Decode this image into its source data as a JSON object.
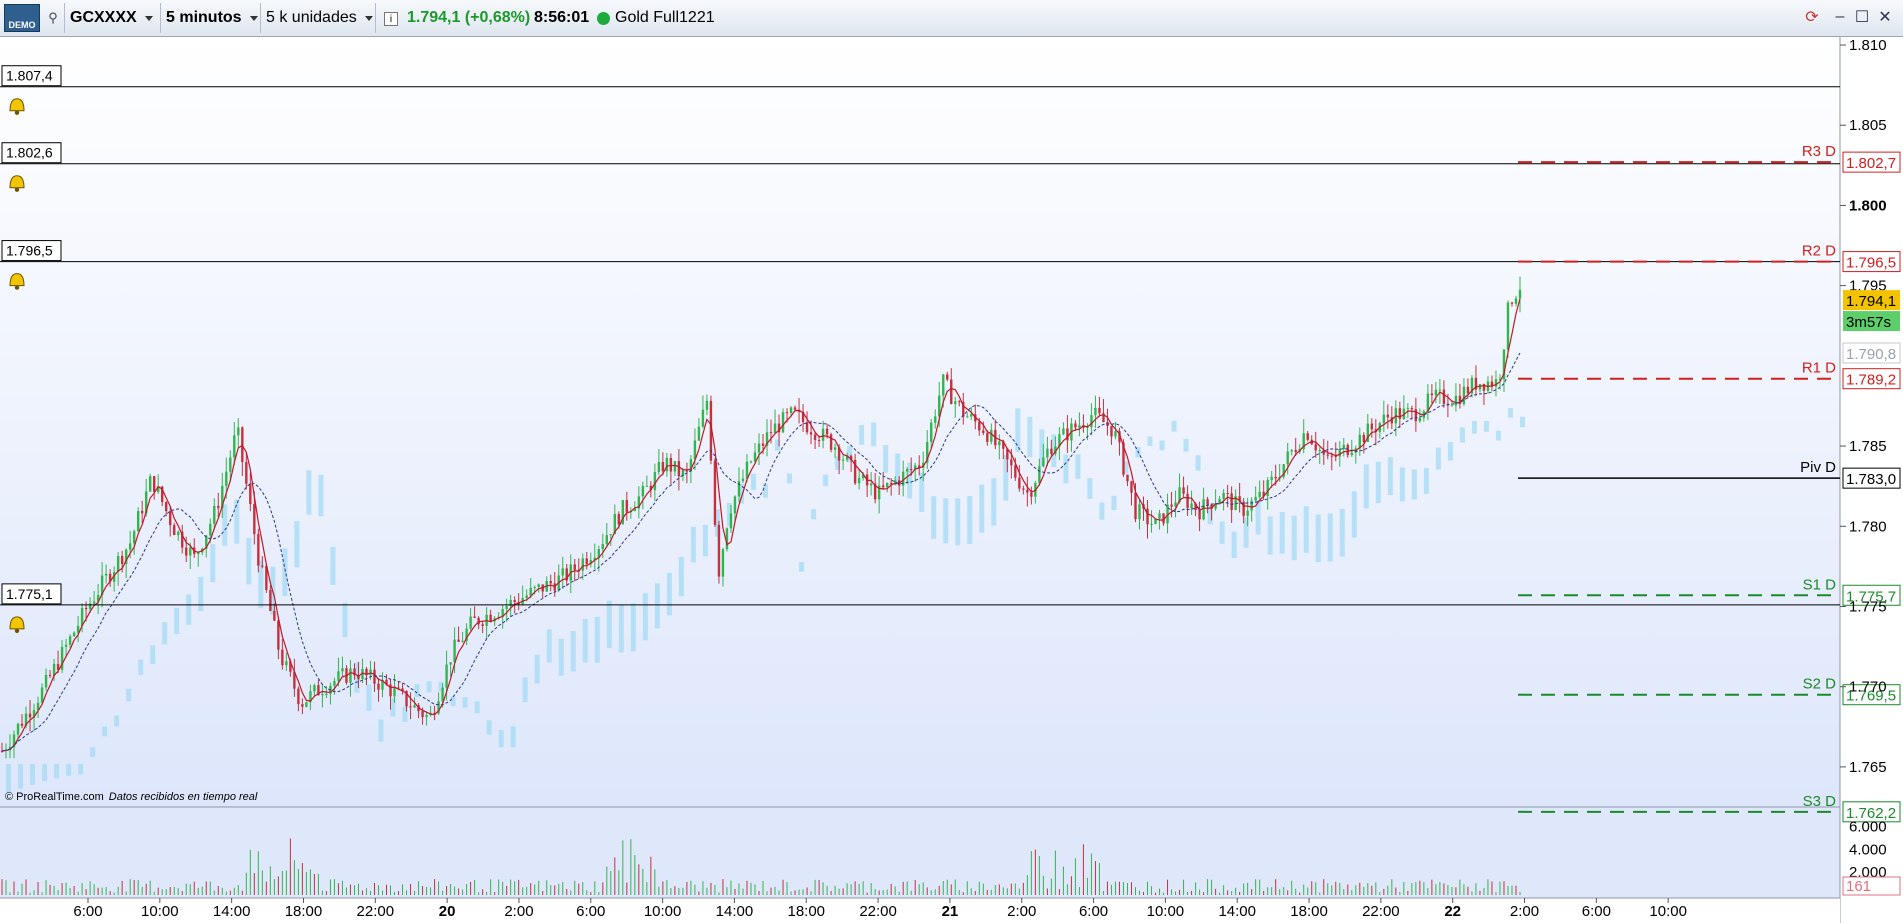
{
  "toolbar": {
    "demo_label": "DEMO",
    "symbol": "GCXXXX",
    "period": "5 minutos",
    "units": "5 k unidades",
    "info_icon": "i",
    "last_price": "1.794,1 (+0,68%)",
    "clock": "8:56:01",
    "instrument": "Gold Full1221",
    "status_color": "#1faa3c",
    "window_buttons": [
      "sync-icon",
      "minimize-icon",
      "maximize-icon",
      "close-icon"
    ]
  },
  "price_axis": {
    "ticks": [
      "1.810",
      "1.805",
      "1.800",
      "1.795",
      "1.785",
      "1.780",
      "1.775",
      "1.770",
      "1.765"
    ],
    "current_price": "1.794,1",
    "countdown": "3m57s",
    "faded_label": "1.790,8"
  },
  "alerts": [
    {
      "label": "1.807,4",
      "value": 1807.4
    },
    {
      "label": "1.802,6",
      "value": 1802.6
    },
    {
      "label": "1.796,5",
      "value": 1796.5
    },
    {
      "label": "1.775,1",
      "value": 1775.1
    }
  ],
  "pivots": [
    {
      "name": "R3 D",
      "label": "1.802,7",
      "value": 1802.7,
      "color": "#d02020"
    },
    {
      "name": "R2 D",
      "label": "1.796,5",
      "value": 1796.5,
      "color": "#d02020"
    },
    {
      "name": "R1 D",
      "label": "1.789,2",
      "value": 1789.2,
      "color": "#d02020"
    },
    {
      "name": "Piv D",
      "label": "1.783,0",
      "value": 1783.0,
      "color": "#000000"
    },
    {
      "name": "S1 D",
      "label": "1.775,7",
      "value": 1775.7,
      "color": "#1a8a2a"
    },
    {
      "name": "S2 D",
      "label": "1.769,5",
      "value": 1769.5,
      "color": "#1a8a2a"
    },
    {
      "name": "S3 D",
      "label": "1.762,2",
      "value": 1762.2,
      "color": "#1a8a2a"
    }
  ],
  "credit": "© ProRealTime.com",
  "credit_note": "Datos recibidos en tiempo real",
  "volume_axis": {
    "ticks": [
      "6.000",
      "4.000",
      "2.000"
    ],
    "last_volume": "161"
  },
  "time_axis": [
    {
      "label": "6:00",
      "bold": false
    },
    {
      "label": "10:00",
      "bold": false
    },
    {
      "label": "14:00",
      "bold": false
    },
    {
      "label": "18:00",
      "bold": false
    },
    {
      "label": "22:00",
      "bold": false
    },
    {
      "label": "20",
      "bold": true
    },
    {
      "label": "2:00",
      "bold": false
    },
    {
      "label": "6:00",
      "bold": false
    },
    {
      "label": "10:00",
      "bold": false
    },
    {
      "label": "14:00",
      "bold": false
    },
    {
      "label": "18:00",
      "bold": false
    },
    {
      "label": "22:00",
      "bold": false
    },
    {
      "label": "21",
      "bold": true
    },
    {
      "label": "2:00",
      "bold": false
    },
    {
      "label": "6:00",
      "bold": false
    },
    {
      "label": "10:00",
      "bold": false
    },
    {
      "label": "14:00",
      "bold": false
    },
    {
      "label": "18:00",
      "bold": false
    },
    {
      "label": "22:00",
      "bold": false
    },
    {
      "label": "22",
      "bold": true
    },
    {
      "label": "2:00",
      "bold": false
    },
    {
      "label": "6:00",
      "bold": false
    },
    {
      "label": "10:00",
      "bold": false
    }
  ],
  "chart_data": {
    "type": "candlestick",
    "ylim": [
      1762.5,
      1810.5
    ],
    "price_path": [
      [
        0,
        1766
      ],
      [
        4,
        1770
      ],
      [
        8,
        1775
      ],
      [
        12,
        1779
      ],
      [
        14,
        1783
      ],
      [
        16,
        1780
      ],
      [
        18,
        1778
      ],
      [
        20,
        1781
      ],
      [
        22,
        1786
      ],
      [
        24,
        1778
      ],
      [
        26,
        1772
      ],
      [
        28,
        1769
      ],
      [
        30,
        1770
      ],
      [
        33,
        1771
      ],
      [
        36,
        1770
      ],
      [
        38,
        1769
      ],
      [
        40,
        1768
      ],
      [
        42,
        1772
      ],
      [
        44,
        1774
      ],
      [
        47,
        1775
      ],
      [
        50,
        1776
      ],
      [
        53,
        1777
      ],
      [
        56,
        1779
      ],
      [
        58,
        1781
      ],
      [
        60,
        1782
      ],
      [
        62,
        1784
      ],
      [
        64,
        1783
      ],
      [
        66,
        1788
      ],
      [
        67,
        1777
      ],
      [
        68,
        1781
      ],
      [
        70,
        1784
      ],
      [
        72,
        1786
      ],
      [
        74,
        1787
      ],
      [
        76,
        1786
      ],
      [
        78,
        1785
      ],
      [
        80,
        1783
      ],
      [
        82,
        1782
      ],
      [
        84,
        1783
      ],
      [
        86,
        1784
      ],
      [
        88,
        1789
      ],
      [
        90,
        1787
      ],
      [
        92,
        1786
      ],
      [
        94,
        1784
      ],
      [
        96,
        1782
      ],
      [
        98,
        1785
      ],
      [
        100,
        1786
      ],
      [
        102,
        1787
      ],
      [
        104,
        1786
      ],
      [
        106,
        1781
      ],
      [
        108,
        1780
      ],
      [
        110,
        1782
      ],
      [
        112,
        1781
      ],
      [
        114,
        1782
      ],
      [
        116,
        1781
      ],
      [
        118,
        1782
      ],
      [
        120,
        1784
      ],
      [
        122,
        1786
      ],
      [
        124,
        1784
      ],
      [
        126,
        1785
      ],
      [
        128,
        1786
      ],
      [
        130,
        1787
      ],
      [
        132,
        1787
      ],
      [
        134,
        1788
      ],
      [
        136,
        1788
      ],
      [
        138,
        1789
      ],
      [
        140,
        1789
      ],
      [
        141,
        1794
      ],
      [
        142,
        1795
      ]
    ]
  }
}
